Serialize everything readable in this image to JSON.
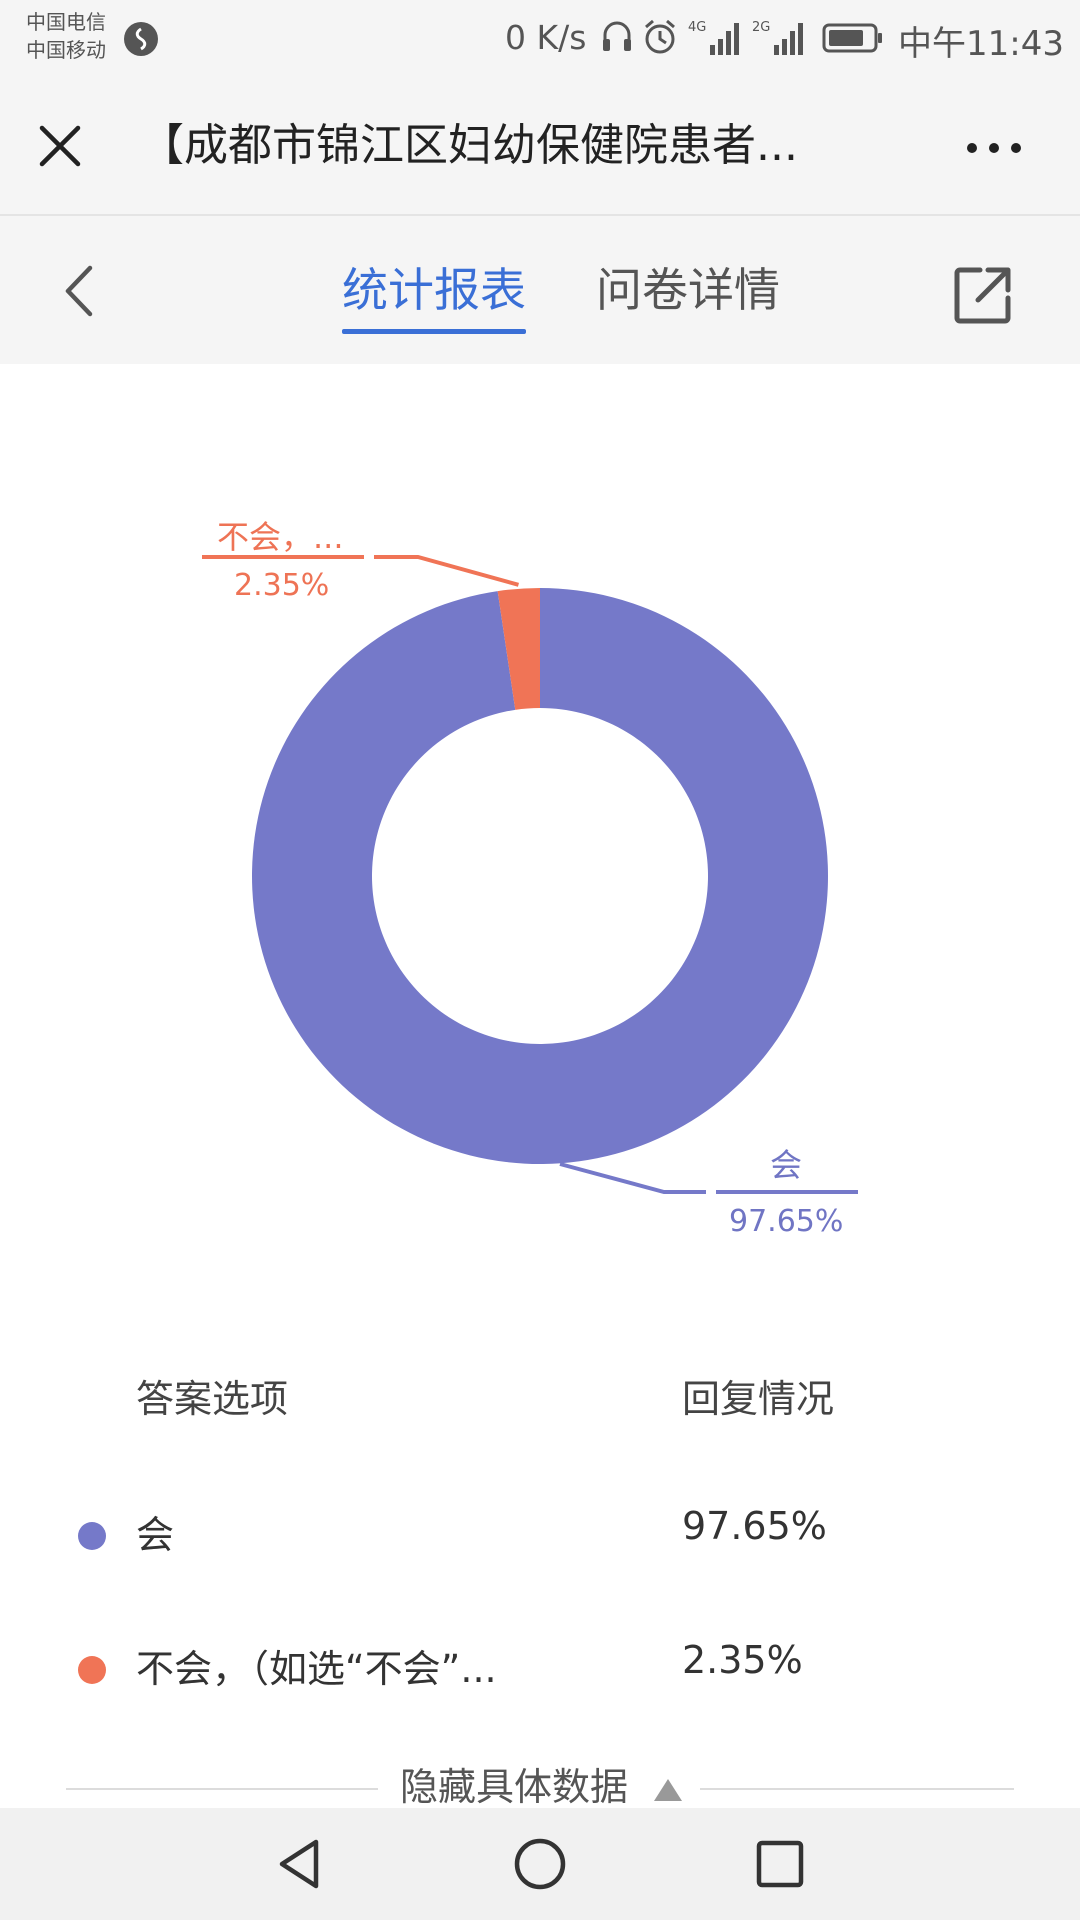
{
  "status_bar": {
    "carrier_1": "中国电信",
    "carrier_2": "中国移动",
    "net_speed": "0 K/s",
    "network_1": "4G",
    "network_2": "2G",
    "time": "中午11:43"
  },
  "title_bar": {
    "title": "【成都市锦江区妇幼保健院患者..."
  },
  "tabs": {
    "stats": "统计报表",
    "detail": "问卷详情"
  },
  "chart_data": {
    "type": "pie",
    "donut": true,
    "slices": [
      {
        "label": "会",
        "value": 97.65,
        "value_label": "97.65%",
        "color": "#7579c9"
      },
      {
        "label": "不会，...",
        "value": 2.35,
        "value_label": "2.35%",
        "color": "#f07456"
      }
    ]
  },
  "table": {
    "header_option": "答案选项",
    "header_reply": "回复情况",
    "rows": [
      {
        "label": "会",
        "value": "97.65%",
        "color": "#7579c9"
      },
      {
        "label": "不会，（如选“不会”...",
        "value": "2.35%",
        "color": "#f07456"
      }
    ]
  },
  "hide_data_label": "隐藏具体数据",
  "colors": {
    "accent": "#3a6fd6",
    "series_yes": "#7579c9",
    "series_no": "#f07456"
  }
}
